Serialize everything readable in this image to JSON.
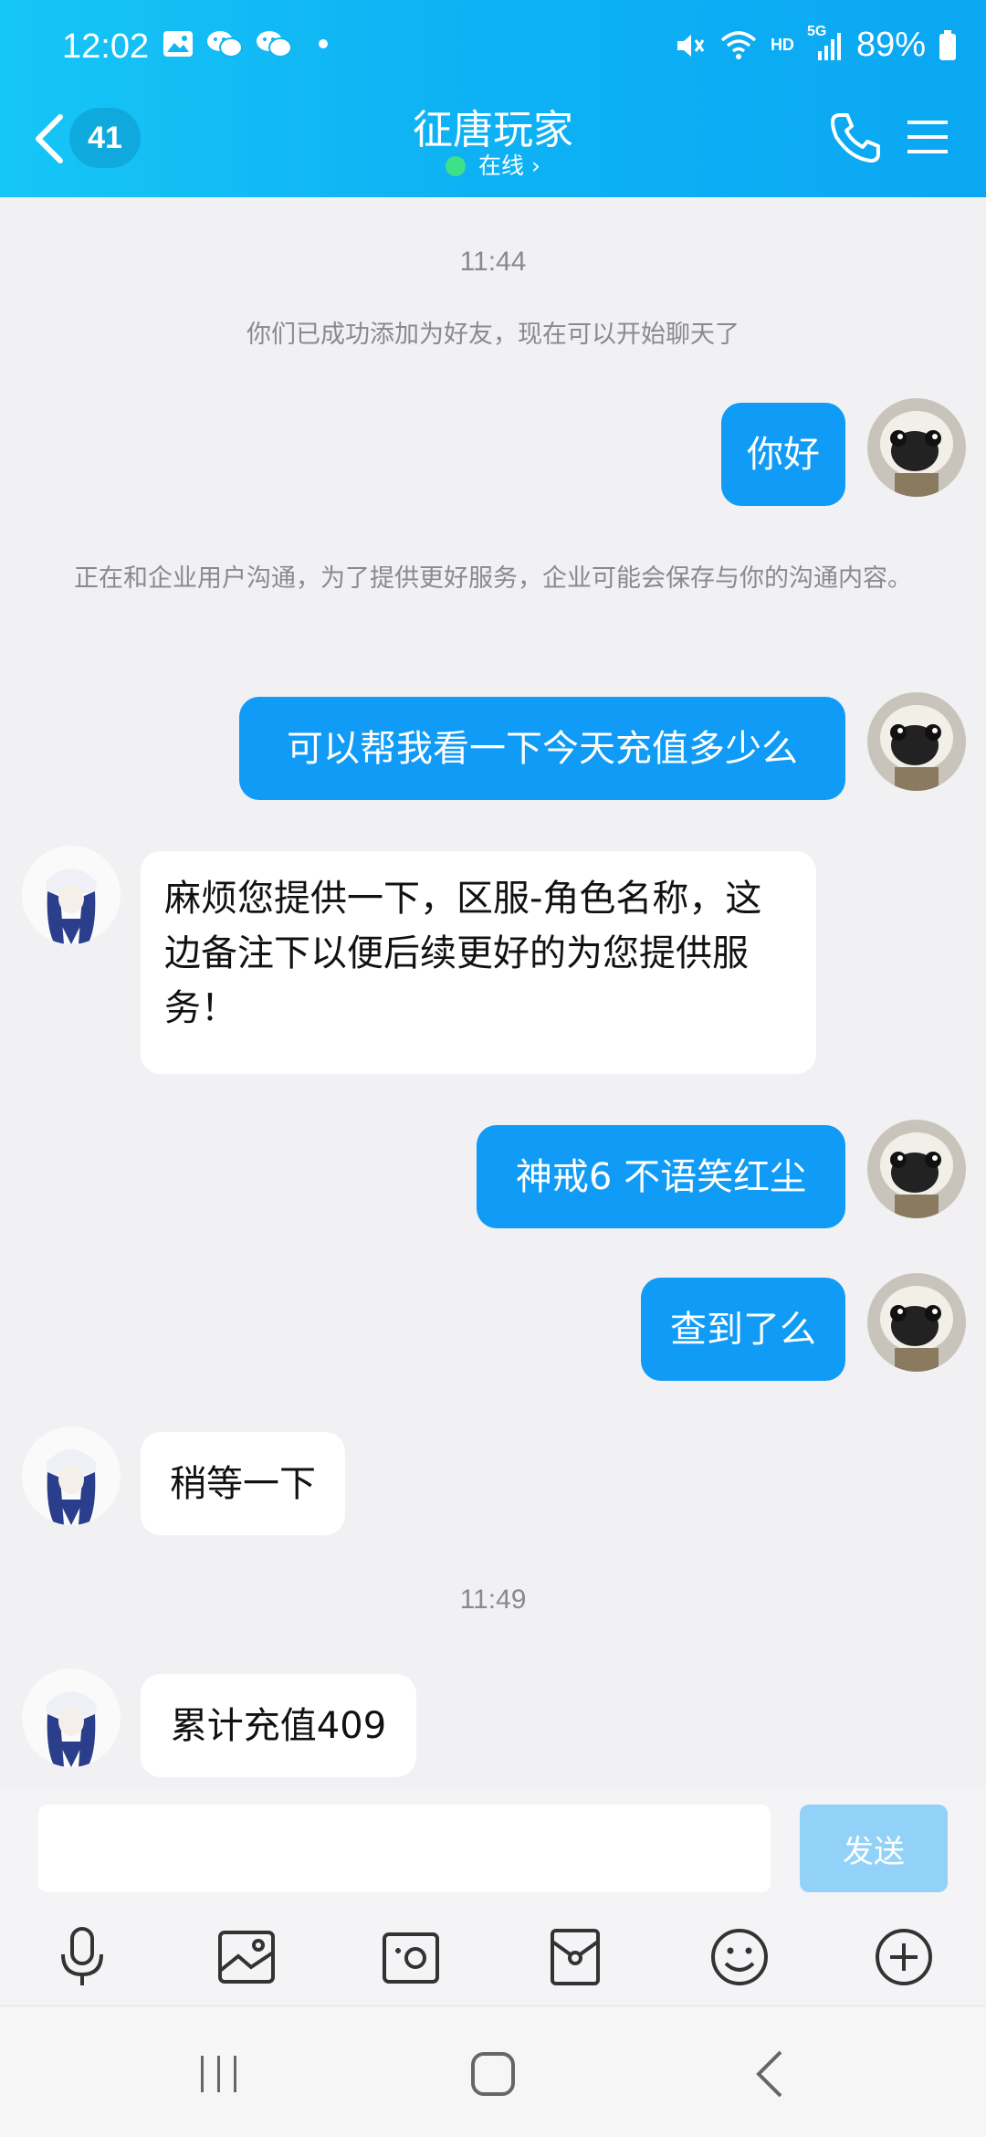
{
  "status_bar": {
    "time": "12:02",
    "battery": "89%",
    "network": "HD",
    "signal": "5G"
  },
  "header": {
    "back_count": "41",
    "title": "征唐玩家",
    "status": "在线 ›"
  },
  "icons": {
    "back": "chevron-left-icon",
    "phone": "phone-icon",
    "menu": "hamburger-menu-icon",
    "voice": "microphone-icon",
    "image": "image-icon",
    "camera": "camera-icon",
    "redpacket": "red-packet-icon",
    "emoji": "smiley-icon",
    "more": "plus-circle-icon"
  },
  "messages": {
    "time1": "11:44",
    "sys1": "你们已成功添加为好友，现在可以开始聊天了",
    "m1": "你好",
    "sys2": "正在和企业用户沟通，为了提供更好服务，企业可能会保存与你的沟通内容。",
    "m2": "可以帮我看一下今天充值多少么",
    "r1": "麻烦您提供一下，区服-角色名称，这边备注下以便后续更好的为您提供服务！",
    "m3": "神戒6  不语笑红尘",
    "m4": "查到了么",
    "r2": "稍等一下",
    "time2": "11:49",
    "r3": "累计充值409"
  },
  "input": {
    "placeholder": "",
    "send_label": "发送"
  },
  "colors": {
    "header": "#0aa7f3",
    "my_bubble": "#109bf6",
    "send_disabled": "#93d2f8"
  }
}
